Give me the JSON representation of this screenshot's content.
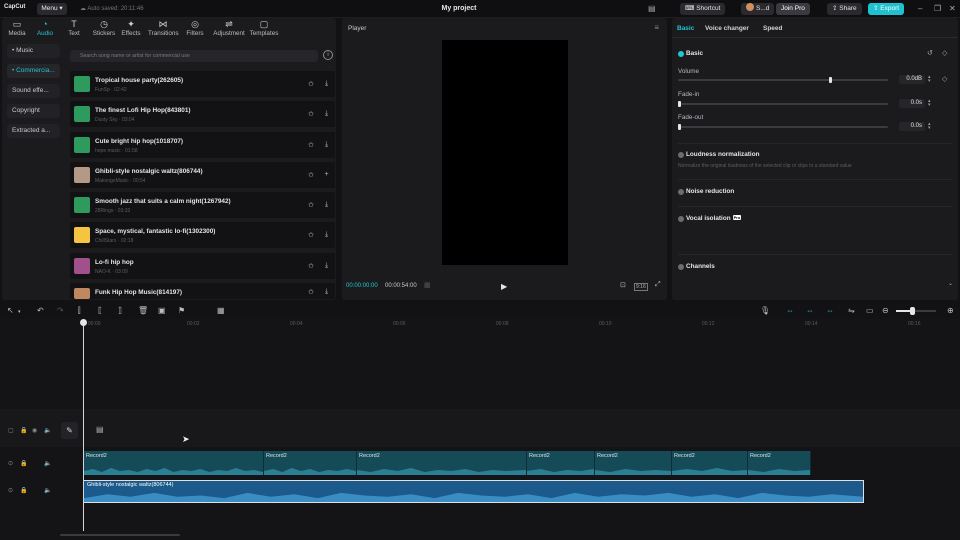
{
  "titlebar": {
    "app_name": "CapCut",
    "menu_label": "Menu",
    "autosave": "Auto saved: 20:11:46",
    "project_title": "My project",
    "shortcut_label": "Shortcut",
    "user_label": "S...d",
    "join_pro_label": "Join Pro",
    "share_label": "Share",
    "export_label": "Export"
  },
  "media_tabs": [
    {
      "label": "Media",
      "icon": "media-icon"
    },
    {
      "label": "Audio",
      "icon": "audio-icon"
    },
    {
      "label": "Text",
      "icon": "text-icon"
    },
    {
      "label": "Stickers",
      "icon": "stickers-icon"
    },
    {
      "label": "Effects",
      "icon": "effects-icon"
    },
    {
      "label": "Transitions",
      "icon": "transitions-icon"
    },
    {
      "label": "Filters",
      "icon": "filters-icon"
    },
    {
      "label": "Adjustment",
      "icon": "adjustment-icon"
    },
    {
      "label": "Templates",
      "icon": "templates-icon"
    }
  ],
  "audio_categories": [
    {
      "label": "• Music"
    },
    {
      "label": "• Commercia..."
    },
    {
      "label": "Sound effe..."
    },
    {
      "label": "Copyright"
    },
    {
      "label": "Extracted a..."
    }
  ],
  "search": {
    "placeholder": "Search song name or artist for commercial use"
  },
  "tracks": [
    {
      "name": "Tropical house party(262605)",
      "meta": "FunSp · 02:42",
      "thumb": "#2e9a5e"
    },
    {
      "name": "The finest Lofi Hip Hop(843801)",
      "meta": "Dusty Sky · 03:04",
      "thumb": "#2e9a5e"
    },
    {
      "name": "Cute bright hip hop(1018707)",
      "meta": "hope music · 01:58",
      "thumb": "#2e9a5e"
    },
    {
      "name": "Ghibli-style nostalgic waltz(806744)",
      "meta": "MakongoMusic · 00:54",
      "thumb": "#b49a86"
    },
    {
      "name": "Smooth jazz that suits a calm night(1267942)",
      "meta": "28Rings · 03:32",
      "thumb": "#2e9a5e"
    },
    {
      "name": "Space, mystical, fantastic lo-fi(1302300)",
      "meta": "ChillStars · 02:18",
      "thumb": "#f5c542"
    },
    {
      "name": "Lo-fi hip hop",
      "meta": "NAO-K · 03:09",
      "thumb": "#a0508a"
    },
    {
      "name": "Funk Hip Hop Music(814197)",
      "meta": "",
      "thumb": "#c08860"
    }
  ],
  "player": {
    "title": "Player",
    "current_time": "00:00:00:00",
    "total_time": "00:00:54:00",
    "ratio_label": "9:16"
  },
  "right_panel": {
    "tabs": [
      "Basic",
      "Voice changer",
      "Speed"
    ],
    "basic_label": "Basic",
    "volume_label": "Volume",
    "volume_value": "0.0dB",
    "volume_level": 0.72,
    "fadein_label": "Fade-in",
    "fadein_value": "0.0s",
    "fadeout_label": "Fade-out",
    "fadeout_value": "0.0s",
    "loudness_label": "Loudness normalization",
    "loudness_desc": "Normalize the original loudness of the selected clip or clips to a standard value",
    "noise_label": "Noise reduction",
    "vocal_label": "Vocal isolation",
    "vocal_badge": "Pro",
    "channels_label": "Channels"
  },
  "timeline": {
    "ticks": [
      "00:00",
      "00:02",
      "00:04",
      "00:06",
      "00:08",
      "00:10",
      "00:12",
      "00:14",
      "00:16"
    ],
    "record_label": "Record2",
    "main_clip_label": "Ghibli-style nostalgic waltz(806744)"
  }
}
